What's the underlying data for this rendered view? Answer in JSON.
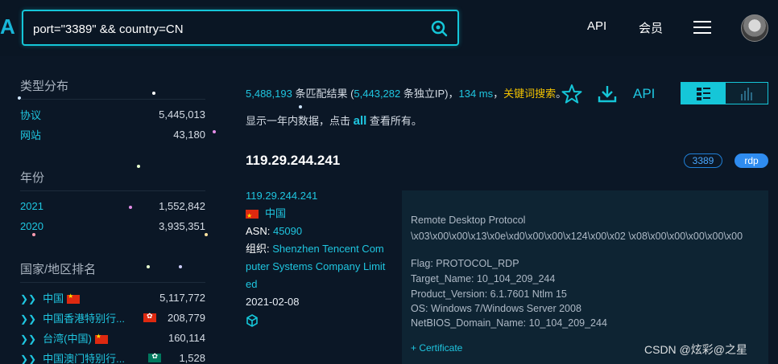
{
  "header": {
    "search_value": "port=\"3389\" && country=CN",
    "nav": [
      "API",
      "会员"
    ]
  },
  "sidebar": {
    "type_title": "类型分布",
    "types": [
      {
        "label": "协议",
        "value": "5,445,013"
      },
      {
        "label": "网站",
        "value": "43,180"
      }
    ],
    "year_title": "年份",
    "years": [
      {
        "label": "2021",
        "value": "1,552,842"
      },
      {
        "label": "2020",
        "value": "3,935,351"
      }
    ],
    "country_title": "国家/地区排名",
    "countries": [
      {
        "label": "中国",
        "value": "5,117,772",
        "flag": "cn"
      },
      {
        "label": "中国香港特别行...",
        "value": "208,779",
        "flag": "hk"
      },
      {
        "label": "台湾(中国)",
        "value": "160,114",
        "flag": "cn"
      },
      {
        "label": "中国澳门特别行...",
        "value": "1,528",
        "flag": "mo"
      }
    ]
  },
  "results": {
    "count": "5,488,193",
    "count_suffix": " 条匹配结果 (",
    "unique": "5,443,282",
    "unique_suffix": " 条独立IP)，",
    "time": "134 ms",
    "time_suffix": "，",
    "keyword_link": "关键词搜索",
    "keyword_suffix": "。",
    "note_prefix": "显示一年内数据，点击 ",
    "note_all": "all",
    "note_suffix": " 查看所有。",
    "api_label": "API"
  },
  "item": {
    "ip": "119.29.244.241",
    "port": "3389",
    "protocol": "rdp",
    "ip_link": "119.29.244.241",
    "country": "中国",
    "asn_label": "ASN: ",
    "asn": "45090",
    "org_label": "组织: ",
    "org_lines": [
      "Shenzhen Tencent Com",
      "puter Systems Company Limit",
      "ed"
    ],
    "date": "2021-02-08",
    "banner_lines": [
      "Remote Desktop Protocol",
      "\\x03\\x00\\x00\\x13\\x0e\\xd0\\x00\\x00\\x124\\x00\\x02 \\x08\\x00\\x00\\x00\\x00\\x00",
      "",
      "Flag: PROTOCOL_RDP",
      "Target_Name: 10_104_209_244",
      "Product_Version: 6.1.7601 Ntlm 15",
      "OS: Windows 7/Windows Server 2008",
      "NetBIOS_Domain_Name: 10_104_209_244"
    ],
    "cert_label": "+ Certificate"
  },
  "watermark": "CSDN @炫彩@之星",
  "colors": {
    "accent": "#15c6d8",
    "highlight": "#f2c200",
    "background": "#0b1726"
  }
}
